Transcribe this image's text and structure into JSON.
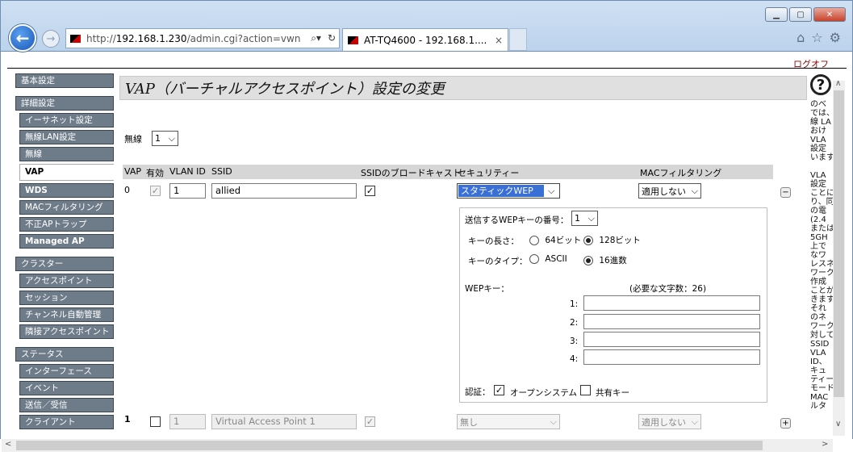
{
  "browser": {
    "url_prefix": "http://",
    "url_host": "192.168.1.230",
    "url_path": "/admin.cgi?action=vwn",
    "tab_title": "AT-TQ4600 - 192.168.1....",
    "tab_close": "×"
  },
  "logout": "ログオフ",
  "sidebar": {
    "group1": [
      "基本設定",
      "詳細設定"
    ],
    "detail_items": [
      "イーサネット設定",
      "無線LAN設定",
      "無線",
      "VAP",
      "WDS",
      "MACフィルタリング",
      "不正APトラップ",
      "Managed AP"
    ],
    "cluster_title": "クラスター",
    "cluster_items": [
      "アクセスポイント",
      "セッション",
      "チャンネル自動管理",
      "隣接アクセスポイント"
    ],
    "status_title": "ステータス",
    "status_items": [
      "インターフェース",
      "イベント",
      "送信／受信",
      "クライアント"
    ]
  },
  "page_title": "VAP（バーチャルアクセスポイント）設定の変更",
  "radio_label": "無線",
  "radio_value": "1",
  "table": {
    "headers": [
      "VAP",
      "有効",
      "VLAN ID",
      "SSID",
      "SSIDのブロードキャスト",
      "セキュリティー",
      "MACフィルタリング"
    ],
    "row0": {
      "vap": "0",
      "vlan": "1",
      "ssid": "allied",
      "security": "スタティックWEP",
      "mac": "適用しない"
    },
    "row1": {
      "vap": "1",
      "vlan": "1",
      "ssid": "Virtual Access Point 1",
      "security": "無し",
      "mac": "適用しない"
    }
  },
  "wep": {
    "key_num_label": "送信するWEPキーの番号：",
    "key_num_value": "1",
    "key_len_label": "キーの長さ：",
    "len_opt1": "64ビット",
    "len_opt2": "128ビット",
    "key_type_label": "キーのタイプ：",
    "type_opt1": "ASCII",
    "type_opt2": "16進数",
    "wep_key_label": "WEPキー：",
    "required_chars": "(必要な文字数：26)",
    "key_labels": [
      "1:",
      "2:",
      "3:",
      "4:"
    ],
    "auth_label": "認証：",
    "auth_open": "オープンシステム",
    "auth_shared": "共有キー"
  },
  "help_text": [
    "のべ",
    "では、",
    "線 LA",
    "おけ",
    "VLA",
    "設定",
    "います",
    "",
    "VLA",
    "設定",
    "ことに",
    "り、同",
    "の電",
    "(2.4",
    "または",
    "5GH",
    "上で",
    "なワ",
    "レスネ",
    "ワーク",
    "作成",
    "ことが",
    "きます",
    "それ",
    "のネ",
    "ワーク",
    "対して",
    "SSID",
    "VLA",
    "ID、",
    "キュ",
    "ティー",
    "モード",
    "MAC",
    "ルタ"
  ]
}
